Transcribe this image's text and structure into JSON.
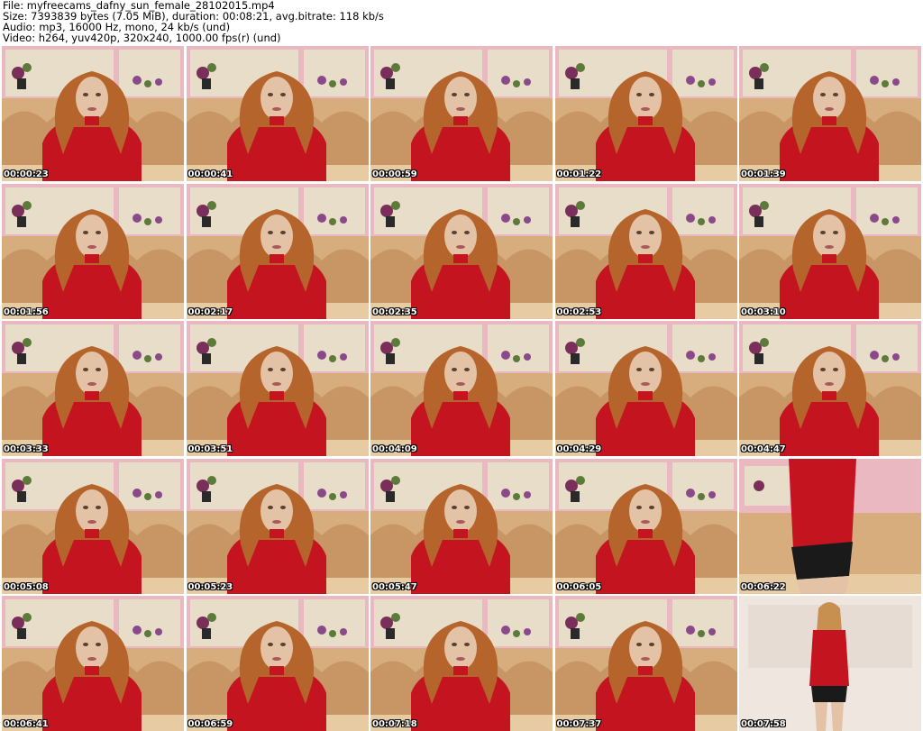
{
  "info": {
    "file_line": "File: myfreecams_dafny_sun_female_28102015.mp4",
    "size_line": "Size: 7393839 bytes (7.05 MiB), duration: 00:08:21, avg.bitrate: 118 kb/s",
    "audio_line": "Audio: mp3, 16000 Hz, mono, 24 kb/s (und)",
    "video_line": "Video: h264, yuv420p, 320x240, 1000.00 fps(r) (und)"
  },
  "colors": {
    "wall": "#f3ebdc",
    "shelf_back": "#e8ddc8",
    "pink_border": "#e9b8c0",
    "couch": "#d7ad7d",
    "couch_shadow": "#b98450",
    "sweater": "#c4141f",
    "hair": "#b5652c",
    "skin": "#e4c2a6",
    "lace": "#1a1a1a"
  },
  "thumbnails": [
    {
      "time": "00:00:23",
      "scene": "sitting"
    },
    {
      "time": "00:00:41",
      "scene": "sitting"
    },
    {
      "time": "00:00:59",
      "scene": "sitting"
    },
    {
      "time": "00:01:22",
      "scene": "sitting"
    },
    {
      "time": "00:01:39",
      "scene": "sitting"
    },
    {
      "time": "00:01:56",
      "scene": "sitting"
    },
    {
      "time": "00:02:17",
      "scene": "sitting"
    },
    {
      "time": "00:02:35",
      "scene": "sitting"
    },
    {
      "time": "00:02:53",
      "scene": "sitting"
    },
    {
      "time": "00:03:10",
      "scene": "sitting"
    },
    {
      "time": "00:03:33",
      "scene": "sitting"
    },
    {
      "time": "00:03:51",
      "scene": "sitting"
    },
    {
      "time": "00:04:09",
      "scene": "sitting"
    },
    {
      "time": "00:04:29",
      "scene": "sitting"
    },
    {
      "time": "00:04:47",
      "scene": "sitting"
    },
    {
      "time": "00:05:08",
      "scene": "sitting"
    },
    {
      "time": "00:05:23",
      "scene": "sitting"
    },
    {
      "time": "00:05:47",
      "scene": "sitting"
    },
    {
      "time": "00:06:05",
      "scene": "sitting"
    },
    {
      "time": "00:06:22",
      "scene": "standing-closeup"
    },
    {
      "time": "00:06:41",
      "scene": "sitting"
    },
    {
      "time": "00:06:59",
      "scene": "sitting"
    },
    {
      "time": "00:07:18",
      "scene": "sitting"
    },
    {
      "time": "00:07:37",
      "scene": "sitting"
    },
    {
      "time": "00:07:58",
      "scene": "standing-full"
    }
  ]
}
